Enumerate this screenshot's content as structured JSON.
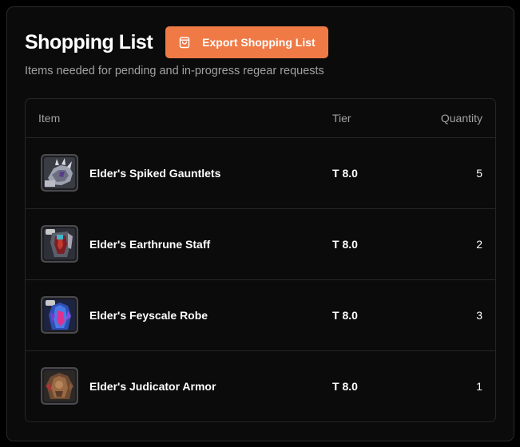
{
  "header": {
    "title": "Shopping List",
    "export_label": "Export Shopping List",
    "export_icon": "shopping-bag-icon",
    "accent_color": "#ef7a46",
    "subtitle": "Items needed for pending and in-progress regear requests"
  },
  "table": {
    "columns": {
      "item": "Item",
      "tier": "Tier",
      "quantity": "Quantity"
    },
    "rows": [
      {
        "name": "Elder's Spiked Gauntlets",
        "tier": "T 8.0",
        "quantity": "5",
        "icon": "spiked-gauntlets-icon"
      },
      {
        "name": "Elder's Earthrune Staff",
        "tier": "T 8.0",
        "quantity": "2",
        "icon": "earthrune-staff-icon"
      },
      {
        "name": "Elder's Feyscale Robe",
        "tier": "T 8.0",
        "quantity": "3",
        "icon": "feyscale-robe-icon"
      },
      {
        "name": "Elder's Judicator Armor",
        "tier": "T 8.0",
        "quantity": "1",
        "icon": "judicator-armor-icon"
      }
    ]
  }
}
